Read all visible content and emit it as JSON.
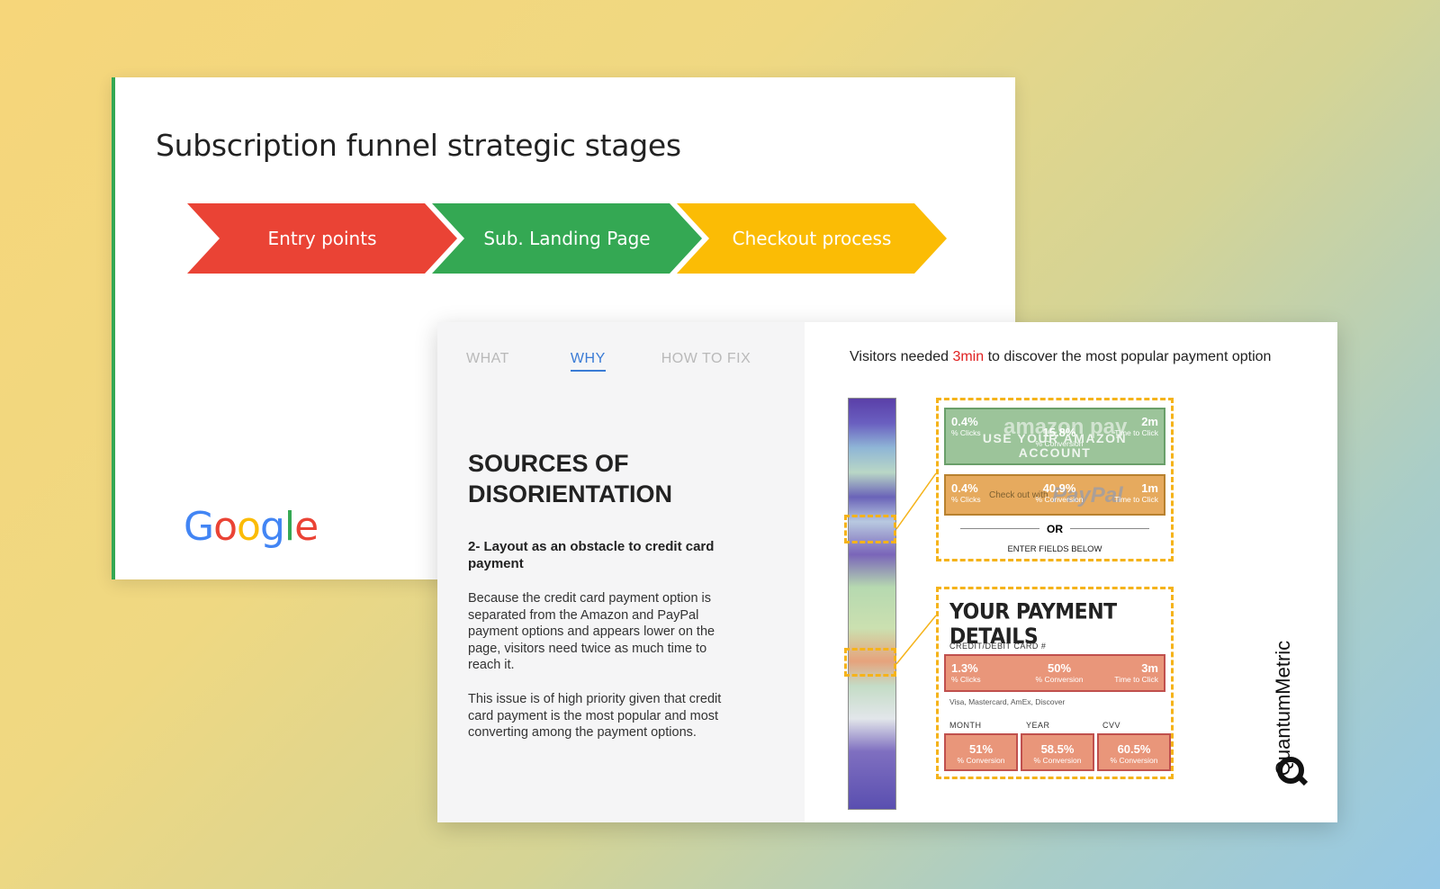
{
  "slide": {
    "title": "Subscription funnel strategic stages",
    "stages": [
      {
        "label": "Entry points",
        "color": "#ea4335"
      },
      {
        "label": "Sub. Landing Page",
        "color": "#34a853"
      },
      {
        "label": "Checkout process",
        "color": "#fbbc05"
      }
    ],
    "logo": {
      "letters": [
        "G",
        "o",
        "o",
        "g",
        "l",
        "e"
      ],
      "colors": [
        "#4285f4",
        "#ea4335",
        "#fbbc05",
        "#4285f4",
        "#34a853",
        "#ea4335"
      ]
    }
  },
  "card": {
    "tabs": [
      {
        "label": "WHAT",
        "active": false
      },
      {
        "label": "WHY",
        "active": true
      },
      {
        "label": "HOW TO FIX",
        "active": false
      }
    ],
    "heading": "SOURCES OF DISORIENTATION",
    "subheading": "2- Layout as an obstacle to credit card payment",
    "paragraph1": "Because the credit card payment option is separated from the Amazon and PayPal payment options and appears lower on the page, visitors need twice as much time to reach it.",
    "paragraph2": "This issue is of high priority given that credit card payment is the most popular and most converting among the payment options.",
    "headline_pre": "Visitors needed ",
    "headline_highlight": "3min",
    "headline_post": " to discover the most popular payment option",
    "amazon": {
      "clicks": "0.4%",
      "clicks_label": "% Clicks",
      "conversion": "15.8%",
      "conversion_label": "% Conversion",
      "time": "2m",
      "time_label": "Time to Click",
      "brand": "amazon pay",
      "cta": "USE YOUR AMAZON ACCOUNT"
    },
    "paypal": {
      "clicks": "0.4%",
      "clicks_label": "% Clicks",
      "conversion": "40.9%",
      "conversion_label": "% Conversion",
      "time": "1m",
      "time_label": "Time to Click",
      "brand": "PayPal",
      "checkout": "Check out with"
    },
    "or_label": "OR",
    "enter_fields": "ENTER FIELDS BELOW",
    "payment_title": "YOUR PAYMENT DETAILS",
    "card_label": "CREDIT/DEBIT CARD #",
    "card_metrics": {
      "clicks": "1.3%",
      "clicks_label": "% Clicks",
      "conversion": "50%",
      "conversion_label": "% Conversion",
      "time": "3m",
      "time_label": "Time to Click"
    },
    "card_types": "Visa, Mastercard, AmEx, Discover",
    "fields": [
      {
        "label": "MONTH",
        "value": "51%",
        "value_label": "% Conversion"
      },
      {
        "label": "YEAR",
        "value": "58.5%",
        "value_label": "% Conversion"
      },
      {
        "label": "CVV",
        "value": "60.5%",
        "value_label": "% Conversion"
      }
    ],
    "brand_mark": "QuantumMetric"
  }
}
